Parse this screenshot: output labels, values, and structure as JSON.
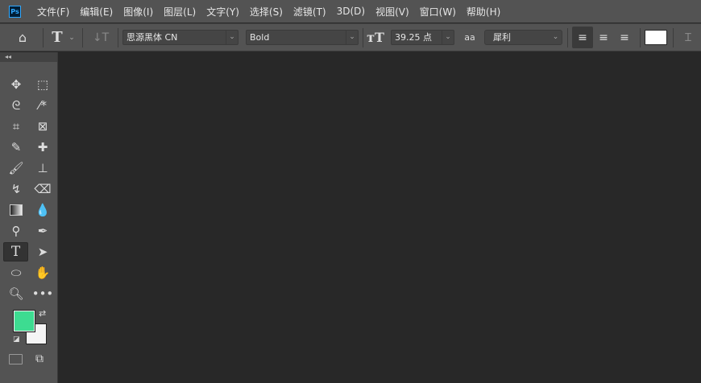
{
  "menubar": {
    "logo": "Ps",
    "items": [
      "文件(F)",
      "编辑(E)",
      "图像(I)",
      "图层(L)",
      "文字(Y)",
      "选择(S)",
      "滤镜(T)",
      "3D(D)",
      "视图(V)",
      "窗口(W)",
      "帮助(H)"
    ]
  },
  "options": {
    "font_family": "思源黑体 CN",
    "font_style": "Bold",
    "font_size": "39.25 点",
    "antialias": "犀利",
    "text_color": "#ffffff",
    "aa_label": "aa"
  },
  "tools": {
    "foreground_color": "#3ddc91",
    "background_color": "#f5f5f5",
    "active": "type-tool"
  }
}
